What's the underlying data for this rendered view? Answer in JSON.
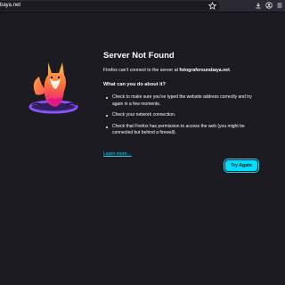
{
  "toolbar": {
    "url": "baya.net",
    "icons": [
      "star-icon",
      "download-icon",
      "account-icon",
      "menu-icon"
    ]
  },
  "error": {
    "title": "Server Not Found",
    "subtitle_prefix": "Firefox can’t connect to the server at ",
    "host": "fotografersurabaya.net",
    "subtitle_suffix": ".",
    "section_heading": "What can you do about it?",
    "tips": [
      "Check to make sure you’ve typed the website address correctly and try again in a few moments.",
      "Check your network connection.",
      "Check that Firefox has permission to access the web (you might be connected but behind a firewall)."
    ],
    "learn_more": "Learn more…",
    "try_again": "Try Again"
  },
  "colors": {
    "background": "#1c1b22",
    "toolbar": "#2b2a33",
    "accent": "#00ddff",
    "text": "#fbfbfe"
  }
}
